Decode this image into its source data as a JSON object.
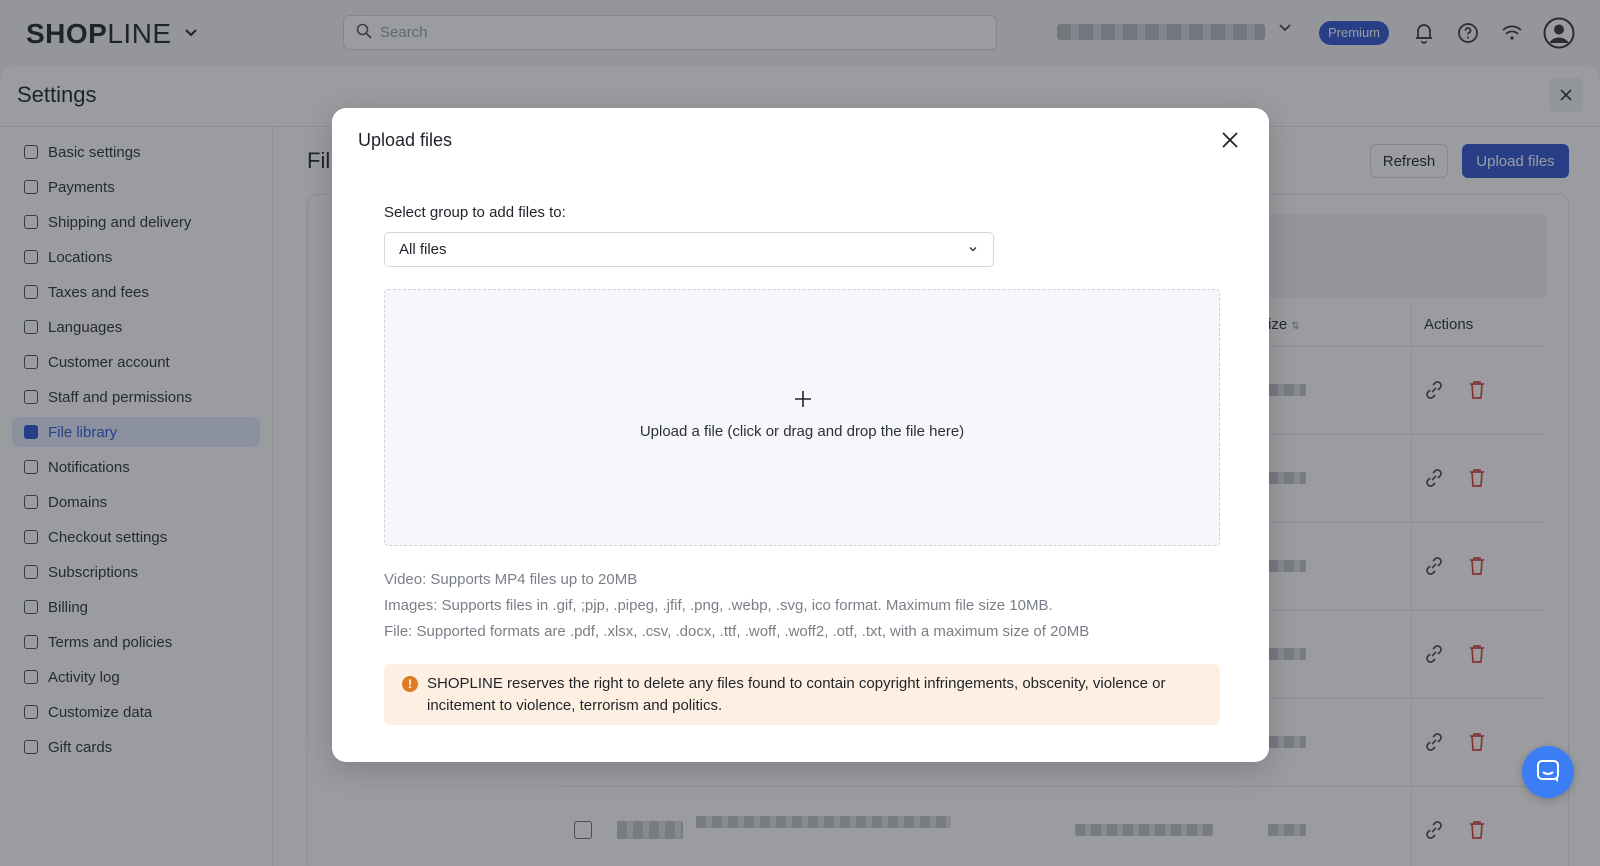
{
  "topbar": {
    "logo_bold": "SHOP",
    "logo_light": "LINE",
    "search_placeholder": "Search",
    "premium_badge": "Premium"
  },
  "settings": {
    "title": "Settings",
    "sidebar": [
      {
        "label": "Basic settings",
        "active": false
      },
      {
        "label": "Payments",
        "active": false
      },
      {
        "label": "Shipping and delivery",
        "active": false
      },
      {
        "label": "Locations",
        "active": false
      },
      {
        "label": "Taxes and fees",
        "active": false
      },
      {
        "label": "Languages",
        "active": false
      },
      {
        "label": "Customer account",
        "active": false
      },
      {
        "label": "Staff and permissions",
        "active": false
      },
      {
        "label": "File library",
        "active": true
      },
      {
        "label": "Notifications",
        "active": false
      },
      {
        "label": "Domains",
        "active": false
      },
      {
        "label": "Checkout settings",
        "active": false
      },
      {
        "label": "Subscriptions",
        "active": false
      },
      {
        "label": "Billing",
        "active": false
      },
      {
        "label": "Terms and policies",
        "active": false
      },
      {
        "label": "Activity log",
        "active": false
      },
      {
        "label": "Customize data",
        "active": false
      },
      {
        "label": "Gift cards",
        "active": false
      }
    ]
  },
  "content": {
    "title": "Fil",
    "refresh_label": "Refresh",
    "upload_label": "Upload files",
    "col_size": "ize",
    "col_actions": "Actions"
  },
  "modal": {
    "title": "Upload files",
    "group_label": "Select group to add files to:",
    "group_value": "All files",
    "dropzone_text": "Upload a file (click or drag and drop the file here)",
    "help_video": "Video: Supports MP4 files up to 20MB",
    "help_images": "Images: Supports files in .gif, ;pjp, .pipeg, .jfif, .png, .webp, .svg, ico format. Maximum file size 10MB.",
    "help_file": "File: Supported formats are .pdf, .xlsx, .csv, .docx, .ttf, .woff, .woff2, .otf, .txt, with a maximum size of 20MB",
    "warning": "SHOPLINE reserves the right to delete any files found to contain copyright infringements, obscenity, violence or incitement to violence, terrorism and politics."
  },
  "colors": {
    "accent": "#3056d3",
    "warning_bg": "#fdf0e2",
    "warning_icon": "#e07b23",
    "delete_icon": "#d9433a",
    "chat": "#3b7df5"
  },
  "icons": [
    "search-icon",
    "chevron-down-icon",
    "bell-icon",
    "help-icon",
    "wifi-icon",
    "user-avatar-icon",
    "close-icon",
    "plus-icon",
    "warning-icon",
    "link-icon",
    "trash-icon",
    "chat-icon"
  ]
}
